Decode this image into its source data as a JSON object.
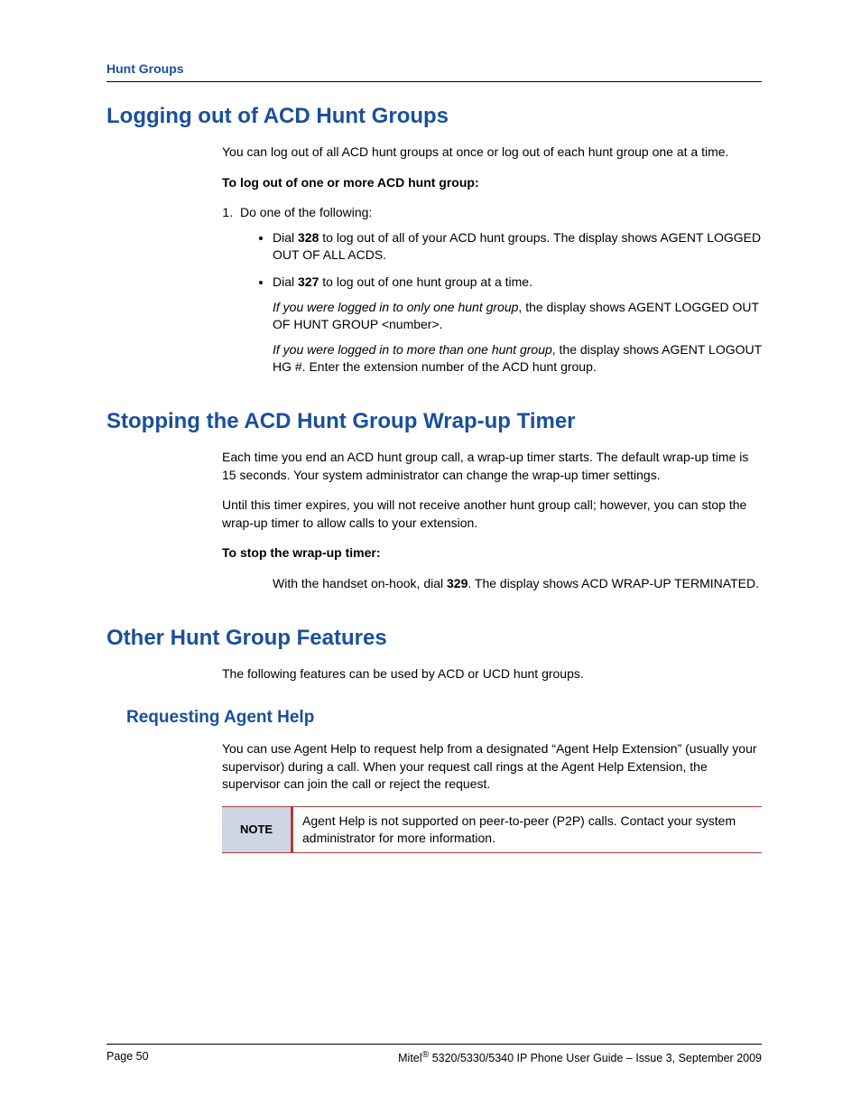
{
  "runningHead": "Hunt Groups",
  "sections": {
    "logout": {
      "title": "Logging out of ACD Hunt Groups",
      "intro": "You can log out of all ACD hunt groups at once or log out of each hunt group one at a time.",
      "howto": "To log out of one or more ACD hunt group:",
      "step1": "Do one of the following:",
      "bullet1_pre": "Dial ",
      "bullet1_code": "328",
      "bullet1_post": " to log out of all of your ACD hunt groups. The display shows AGENT LOGGED OUT OF ALL ACDS.",
      "bullet2_pre": "Dial ",
      "bullet2_code": "327",
      "bullet2_post": " to log out of one hunt group at a time.",
      "cond1_em": "If you were logged in to only one hunt group",
      "cond1_rest": ", the display shows AGENT LOGGED OUT OF HUNT GROUP <number>.",
      "cond2_em": "If you were logged in to more than one hunt group",
      "cond2_rest": ", the display shows AGENT LOGOUT HG #. Enter the extension number of the ACD hunt group."
    },
    "wrapup": {
      "title": "Stopping the ACD Hunt Group Wrap-up Timer",
      "p1": "Each time you end an ACD hunt group call, a wrap-up timer starts. The default wrap-up time is 15 seconds. Your system administrator can change the wrap-up timer settings.",
      "p2": "Until this timer expires, you will not receive another hunt group call; however, you can stop the wrap-up timer to allow calls to your extension.",
      "howto": "To stop the wrap-up timer:",
      "dial_pre": "With the handset on-hook, dial ",
      "dial_code": "329",
      "dial_post": ". The display shows ACD WRAP-UP TERMINATED."
    },
    "other": {
      "title": "Other Hunt Group Features",
      "intro": "The following features can be used by ACD or UCD hunt groups.",
      "sub_title": "Requesting Agent Help",
      "sub_body": "You can use Agent Help to request help from a designated “Agent Help Extension” (usually your supervisor) during a call. When your request call rings at the Agent Help Extension, the supervisor can join the call or reject the request.",
      "note_label": "NOTE",
      "note_text": "Agent Help is not supported on peer-to-peer (P2P) calls. Contact your system administrator for more information."
    }
  },
  "footer": {
    "left": "Page 50",
    "right_pre": "Mitel",
    "right_post": " 5320/5330/5340 IP Phone User Guide  – Issue 3, September 2009"
  }
}
